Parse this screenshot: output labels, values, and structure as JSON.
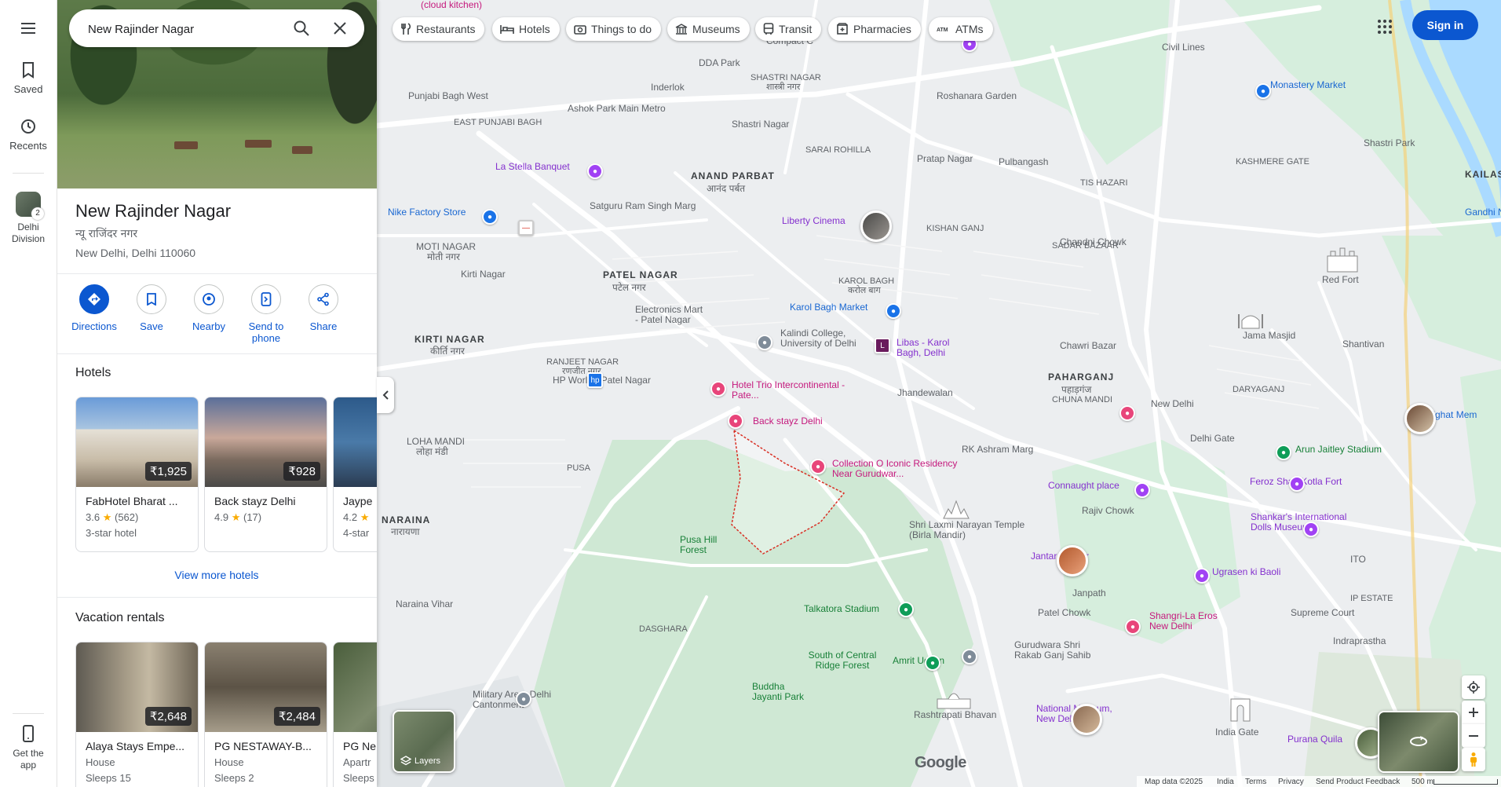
{
  "search": {
    "value": "New Rajinder Nagar"
  },
  "rail": {
    "saved": "Saved",
    "recents": "Recents",
    "recent_place": "Delhi Division",
    "recent_count": "2",
    "get_app": "Get the app"
  },
  "place": {
    "title": "New Rajinder Nagar",
    "subtitle": "न्यू राजिंदर नगर",
    "address": "New Delhi, Delhi 110060"
  },
  "actions": [
    {
      "label": "Directions"
    },
    {
      "label": "Save"
    },
    {
      "label": "Nearby"
    },
    {
      "label": "Send to phone"
    },
    {
      "label": "Share"
    }
  ],
  "hotels": {
    "title": "Hotels",
    "more": "View more hotels",
    "items": [
      {
        "price": "₹1,925",
        "name": "FabHotel Bharat ...",
        "rating": "3.6",
        "reviews": "(562)",
        "type": "3-star hotel"
      },
      {
        "price": "₹928",
        "name": "Back stayz Delhi",
        "rating": "4.9",
        "reviews": "(17)",
        "type": ""
      },
      {
        "price": "",
        "name": "Jaype",
        "rating": "4.2",
        "reviews": "",
        "type": "4-star"
      }
    ]
  },
  "rentals": {
    "title": "Vacation rentals",
    "items": [
      {
        "price": "₹2,648",
        "name": "Alaya Stays Empe...",
        "type": "House",
        "sleeps": "Sleeps 15"
      },
      {
        "price": "₹2,484",
        "name": "PG NESTAWAY-B...",
        "type": "House",
        "sleeps": "Sleeps 2"
      },
      {
        "price": "",
        "name": "PG Ne",
        "type": "Apartr",
        "sleeps": "Sleeps"
      }
    ]
  },
  "chips": [
    {
      "label": "Restaurants",
      "icon": "fork-knife-icon"
    },
    {
      "label": "Hotels",
      "icon": "bed-icon"
    },
    {
      "label": "Things to do",
      "icon": "camera-icon"
    },
    {
      "label": "Museums",
      "icon": "museum-icon"
    },
    {
      "label": "Transit",
      "icon": "bus-icon"
    },
    {
      "label": "Pharmacies",
      "icon": "pharmacy-icon"
    },
    {
      "label": "ATMs",
      "icon": "atm-icon"
    }
  ],
  "header": {
    "signin": "Sign in"
  },
  "map": {
    "layers": "Layers",
    "google": "Google",
    "attribution": {
      "data": "Map data ©2025",
      "india": "India",
      "terms": "Terms",
      "privacy": "Privacy",
      "feedback": "Send Product Feedback",
      "scale": "500 m"
    },
    "labels": {
      "anand_parbat": "ANAND PARBAT",
      "anand_parbat_hi": "आनंद पर्बत",
      "patel_nagar": "PATEL NAGAR",
      "patel_nagar_hi": "पटेल नगर",
      "kirti_nagar": "KIRTI NAGAR",
      "kirti_nagar_hi": "कीर्ति नगर",
      "naraina": "NARAINA",
      "naraina_hi": "नारायणा",
      "paharganj": "PAHARGANJ",
      "paharganj_hi": "पहाड़गंज",
      "loha_mandi": "LOHA MANDI",
      "loha_mandi_hi": "लोहा मंडी",
      "moti_nagar": "MOTI NAGAR",
      "moti_nagar_hi": "मोती नगर",
      "karol_bagh": "KAROL BAGH",
      "karol_bagh_hi": "करोल बाग",
      "ranjeet_nagar": "RANJEET NAGAR",
      "ranjeet_nagar_hi": "रणजीत नगर",
      "shastri_nagar": "SHASTRI NAGAR",
      "shastri_nagar_hi": "शास्त्री नगर",
      "sarai_rohilla": "SARAI ROHILLA",
      "kishan_ganj": "KISHAN GANJ",
      "sadar_bazaar": "SADAR BAZAAR",
      "kashmere_gate": "KASHMERE GATE",
      "tis_hazari": "TIS HAZARI",
      "chuna_mandi": "CHUNA MANDI",
      "daryaganj": "DARYAGANJ",
      "east_punjabi_bagh": "EAST PUNJABI BAGH",
      "dasghara": "DASGHARA",
      "ip_estate": "IP ESTATE",
      "kailash": "KAILASH",
      "pusa": "PUSA",
      "ddapark": "DDA Park",
      "inderlok": "Inderlok",
      "shastri_nagar2": "Shastri Nagar",
      "pratap_nagar": "Pratap Nagar",
      "pulbangash": "Pulbangash",
      "roshanara": "Roshanara Garden",
      "civil_lines": "Civil Lines",
      "monastery": "Monastery Market",
      "shastri_park": "Shastri Park",
      "punjabi_bagh_west": "Punjabi Bagh West",
      "ashok_park": "Ashok Park Main Metro",
      "la_stella": "La Stella Banquet",
      "satguru": "Satguru Ram Singh Marg",
      "nike": "Nike Factory Store",
      "liberty": "Liberty Cinema",
      "chandni_chowk": "Chandni Chowk",
      "red_fort": "Red Fort",
      "jama_masjid": "Jama Masjid",
      "gandhi_nagar": "Gandhi Nagar",
      "kirti_nagar2": "Kirti Nagar",
      "electronics": "Electronics Mart - Patel Nagar",
      "karol_bagh_market": "Karol Bagh Market",
      "kalindi": "Kalindi College, University of Delhi",
      "libas": "Libas - Karol Bagh, Delhi",
      "chawri": "Chawri Bazar",
      "shantivan": "Shantivan",
      "hp_world": "HP World - Patel Nagar",
      "hotel_trio": "Hotel Trio Intercontinental - Pate...",
      "back_stayz": "Back stayz Delhi",
      "jhandewalan": "Jhandewalan",
      "new_delhi": "New Delhi",
      "rajghat": "Rajghat Mem",
      "collection_o": "Collection O Iconic Residency Near Gurudwar...",
      "rk_ashram": "RK Ashram Marg",
      "delhi_gate": "Delhi Gate",
      "arun_jaitley": "Arun Jaitley Stadium",
      "connaught": "Connaught place",
      "feroz_shah": "Feroz Shah Kotla Fort",
      "rajiv_chowk": "Rajiv Chowk",
      "birla": "Shri Laxmi Narayan Temple (Birla Mandir)",
      "shankars": "Shankar's International Dolls Museum",
      "pusa_hill": "Pusa Hill Forest",
      "jantar": "Jantar Mantar",
      "ito": "ITO",
      "janpath": "Janpath",
      "ugrasen": "Ugrasen ki Baoli",
      "naraina_vihar": "Naraina Vihar",
      "talkatora": "Talkatora Stadium",
      "patel_chowk": "Patel Chowk",
      "supreme_court": "Supreme Court",
      "shangri": "Shangri-La Eros New Delhi",
      "indraprastha": "Indraprastha",
      "gurudwara": "Gurudwara Shri Rakab Ganj Sahib",
      "amrit_udyan": "Amrit Udyan",
      "south_central": "South of Central Ridge Forest",
      "military": "Military Area, Delhi Cantonment",
      "buddha": "Buddha Jayanti Park",
      "rashtrapati": "Rashtrapati Bhavan",
      "national_museum": "National Museum, New Delhi",
      "india_gate": "India Gate",
      "purana_quila": "Purana Quila",
      "cloud_kitchen": "(cloud kitchen)",
      "compact": "Compact C"
    }
  }
}
